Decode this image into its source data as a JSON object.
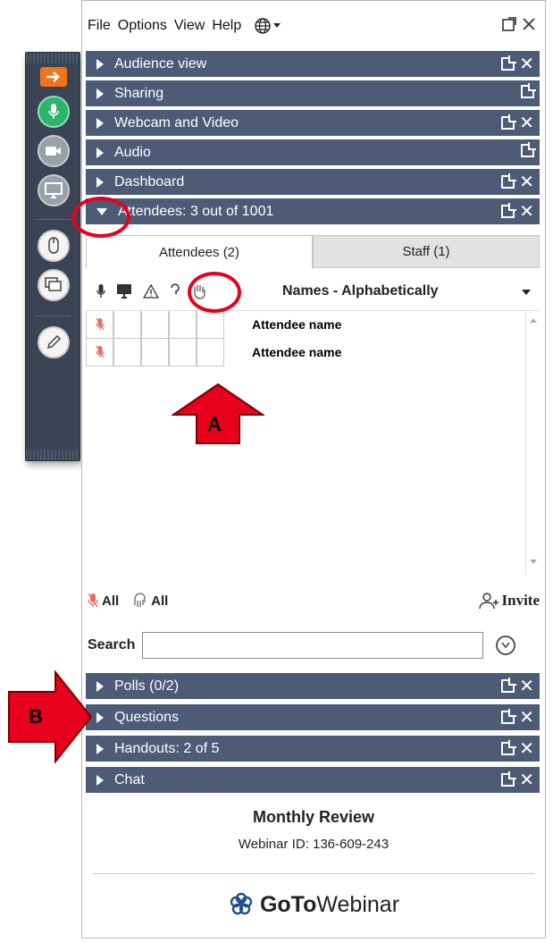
{
  "menu": {
    "items": [
      "File",
      "Options",
      "View",
      "Help"
    ],
    "globe_icon": "globe-icon"
  },
  "sections_top": [
    {
      "label": "Audience view",
      "has_close": true
    },
    {
      "label": "Sharing",
      "has_close": false
    },
    {
      "label": "Webcam and Video",
      "has_close": true
    },
    {
      "label": "Audio",
      "has_close": false
    },
    {
      "label": "Dashboard",
      "has_close": true
    }
  ],
  "attendees_section": {
    "label": "Attendees:  3 out of 1001",
    "expanded": true
  },
  "tabs": {
    "attendees": "Attendees (2)",
    "staff": "Staff (1)"
  },
  "column_header": {
    "sort_label": "Names - Alphabetically"
  },
  "attendee_rows": [
    {
      "name": "Attendee name"
    },
    {
      "name": "Attendee name"
    }
  ],
  "actions": {
    "mute_all": "All",
    "hands_all": "All",
    "invite": "Invite"
  },
  "search": {
    "label": "Search",
    "value": ""
  },
  "sections_bottom": [
    {
      "label": "Polls (0/2)"
    },
    {
      "label": "Questions"
    },
    {
      "label": "Handouts: 2 of 5"
    },
    {
      "label": "Chat"
    }
  ],
  "footer": {
    "title": "Monthly Review",
    "webinar_id": "Webinar ID: 136-609-243",
    "brand_bold": "GoTo",
    "brand_light": "Webinar"
  },
  "callouts": {
    "a": "A",
    "b": "B"
  },
  "colors": {
    "section_bar": "#4d5b77",
    "toolbar": "#3b4454",
    "accent_orange": "#f2731c",
    "mic_green": "#2db46a",
    "annotation_red": "#e8001c"
  }
}
